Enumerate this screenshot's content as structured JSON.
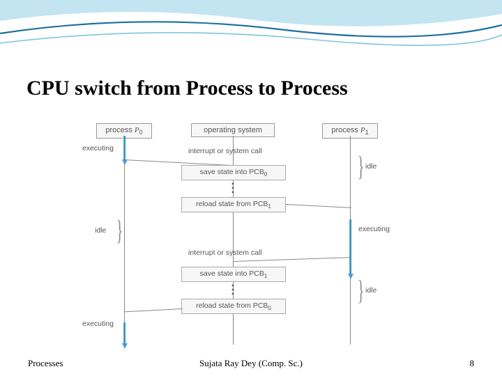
{
  "title": "CPU switch from Process to Process",
  "columns": {
    "p0_prefix": "process ",
    "p0_var": "P",
    "p0_sub": "0",
    "os": "operating system",
    "p1_prefix": "process ",
    "p1_var": "P",
    "p1_sub": "1"
  },
  "events": {
    "interrupt1": "interrupt or system call",
    "interrupt2": "interrupt or system call"
  },
  "ops": {
    "save_pcb0_prefix": "save state into PCB",
    "save_pcb0_sub": "0",
    "reload_pcb1_prefix": "reload state from PCB",
    "reload_pcb1_sub": "1",
    "save_pcb1_prefix": "save state into PCB",
    "save_pcb1_sub": "1",
    "reload_pcb0_prefix": "reload state from PCB",
    "reload_pcb0_sub": "0"
  },
  "labels": {
    "executing": "executing",
    "idle": "idle"
  },
  "footer": {
    "left": "Processes",
    "center": "Sujata Ray Dey (Comp. Sc.)",
    "right": "8"
  }
}
